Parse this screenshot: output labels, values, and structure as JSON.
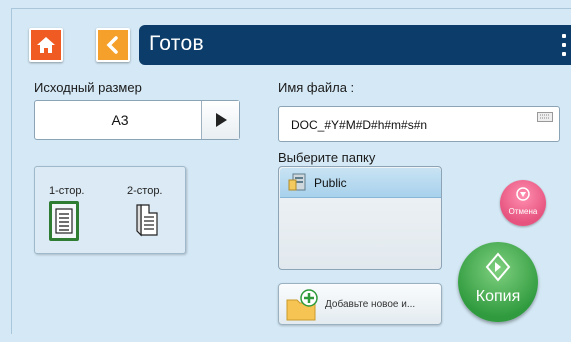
{
  "header": {
    "title": "Готов",
    "home_icon": "home-icon",
    "back_icon": "chevron-left-icon",
    "menu_icon": "more-vert-icon"
  },
  "original_size": {
    "label": "Исходный размер",
    "value": "A3"
  },
  "sides": {
    "one_sided_label": "1-стор.",
    "two_sided_label": "2-стор.",
    "selected": "1-стор."
  },
  "filename": {
    "label": "Имя файла :",
    "value": "DOC_#Y#M#D#h#m#s#n"
  },
  "folder": {
    "label": "Выберите папку",
    "items": [
      {
        "label": "Public",
        "selected": true
      }
    ],
    "add_label": "Добавьте новое и..."
  },
  "actions": {
    "cancel_label": "Отмена",
    "copy_label": "Копия"
  },
  "colors": {
    "background": "#d4e8f5",
    "title_bar": "#0c3d6a",
    "home_button": "#f05a23",
    "back_button": "#f5a02a",
    "cancel_button": "#e6537f",
    "copy_button": "#2f9a3e",
    "selected_border": "#2e7d32"
  }
}
